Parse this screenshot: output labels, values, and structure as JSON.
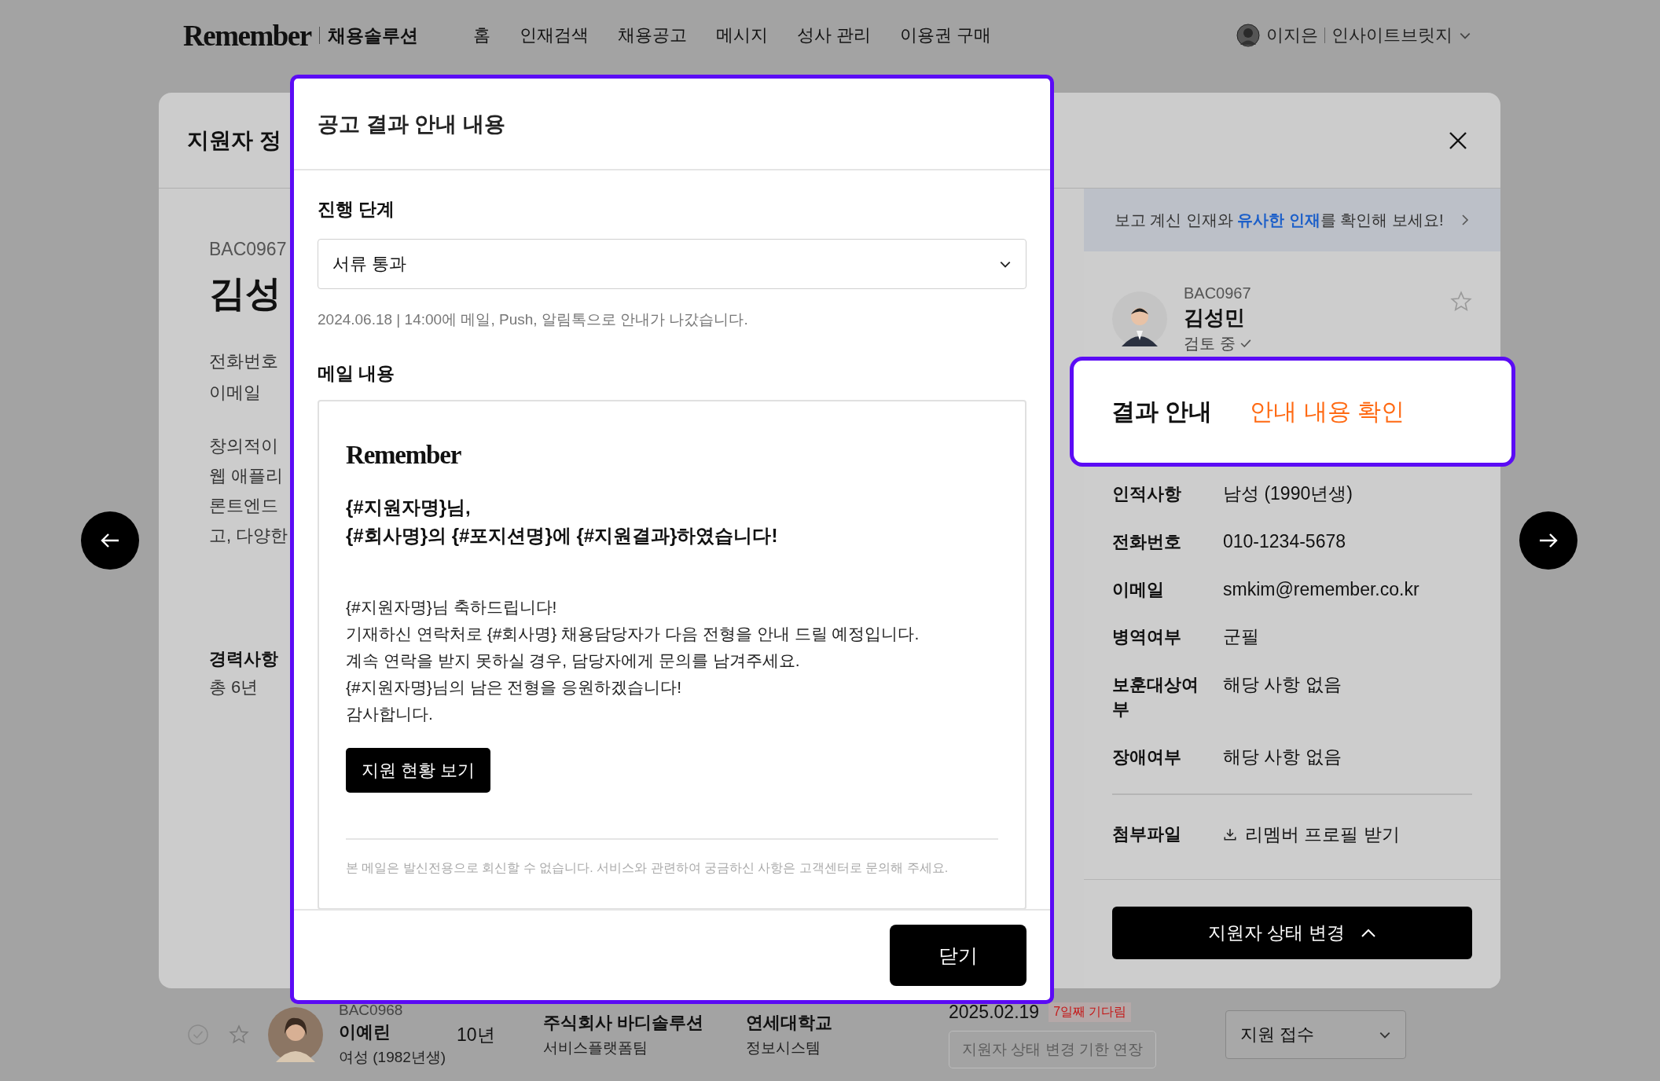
{
  "nav": {
    "logo": "Remember",
    "product": "채용솔루션",
    "items": [
      "홈",
      "인재검색",
      "채용공고",
      "메시지",
      "성사 관리",
      "이용권 구매"
    ],
    "user": {
      "name": "이지은",
      "company": "인사이트브릿지"
    }
  },
  "sheet": {
    "title": "지원자 정",
    "left": {
      "code": "BAC0967",
      "name": "김성",
      "fields": [
        "전화번호",
        "이메일"
      ],
      "intro": [
        "창의적이",
        "웹 애플리",
        "론트엔드",
        "고, 다양한"
      ],
      "career_label": "경력사항",
      "career_value": "총 6년"
    },
    "banner": "보고 계신 인재와 **유사한 인재**를 확인해 보세요!",
    "profile": {
      "code": "BAC0967",
      "name": "김성민",
      "status": "검토 중",
      "starred": false
    },
    "info": [
      {
        "label": "인적사항",
        "value": "남성 (1990년생)"
      },
      {
        "label": "전화번호",
        "value": "010-1234-5678"
      },
      {
        "label": "이메일",
        "value": "smkim@remember.co.kr"
      },
      {
        "label": "병역여부",
        "value": "군필"
      },
      {
        "label": "보훈대상여부",
        "value": "해당 사항 없음"
      },
      {
        "label": "장애여부",
        "value": "해당 사항 없음"
      }
    ],
    "attachments": {
      "label": "첨부파일",
      "files": [
        "리멤버 프로필 받기"
      ]
    },
    "status_button": "지원자 상태 변경"
  },
  "result_callout": {
    "label": "결과 안내",
    "link": "안내 내용 확인"
  },
  "modal": {
    "title": "공고 결과 안내 내용",
    "stage_label": "진행 단계",
    "stage_value": "서류 통과",
    "note": "2024.06.18 | 14:00에 메일, Push, 알림톡으로 안내가 나갔습니다.",
    "mail_label": "메일 내용",
    "mail": {
      "logo": "Remember",
      "heading": [
        "{#지원자명}님,",
        "{#회사명}의 {#포지션명}에 {#지원결과}하였습니다!"
      ],
      "body": [
        "{#지원자명}님 축하드립니다!",
        "기재하신 연락처로 {#회사명} 채용담당자가 다음 전형을 안내 드릴 예정입니다.",
        "계속 연락을 받지 못하실 경우, 담당자에게 문의를 남겨주세요.",
        "{#지원자명}님의 남은 전형을 응원하겠습니다!",
        "감사합니다."
      ],
      "button": "지원 현황 보기",
      "footer": "본 메일은 발신전용으로 회신할 수 없습니다. 서비스와 관련하여 궁금하신 사항은 고객센터로 문의해 주세요."
    },
    "close": "닫기"
  },
  "applicant_row": {
    "checked": false,
    "starred": false,
    "code": "BAC0968",
    "name": "이예린",
    "profile": "여성 (1982년생)",
    "experience": "10년",
    "company": "주식회사 바디솔루션",
    "team": "서비스플랫폼팀",
    "school": "연세대학교",
    "major": "정보시스템",
    "date": "2025.02.19",
    "waiting": "7일째 기다림",
    "extend_button": "지원자 상태 변경 기한 연장",
    "extend_disabled": true,
    "status": "지원 접수"
  }
}
